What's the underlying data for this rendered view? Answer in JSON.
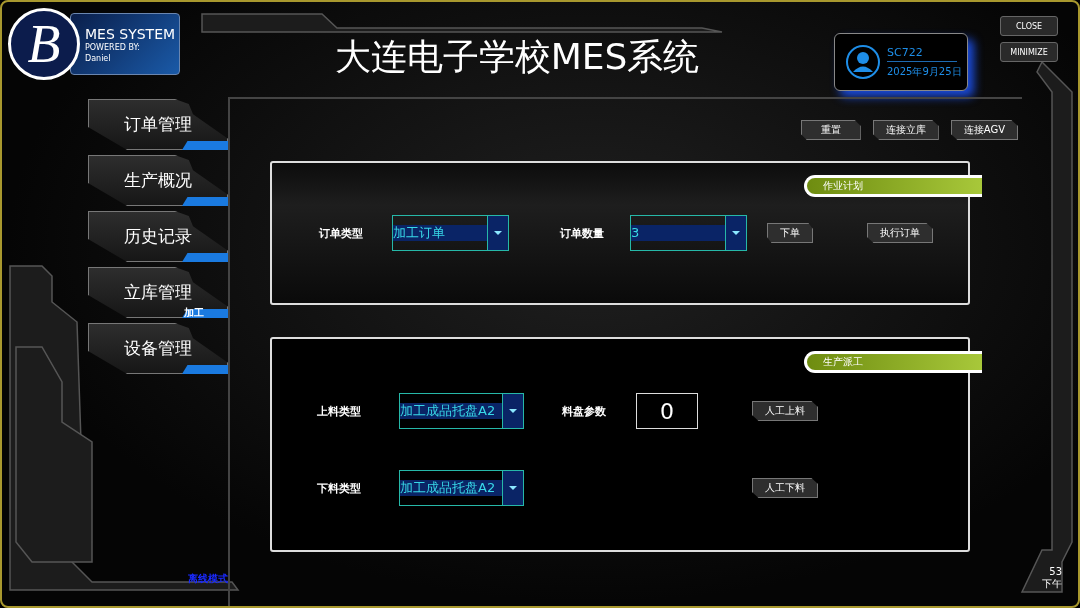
{
  "header": {
    "logo_letter": "B",
    "product": "MES SYSTEM",
    "powered_by": "POWERED BY:",
    "author": "Daniel",
    "title": "大连电子学校MES系统"
  },
  "user": {
    "name": "SC722",
    "date": "2025年9月25日"
  },
  "window_buttons": [
    "CLOSE",
    "MINIMIZE"
  ],
  "sidebar": {
    "items": [
      {
        "label": "订单管理"
      },
      {
        "label": "生产概况"
      },
      {
        "label": "历史记录"
      },
      {
        "label": "立库管理",
        "badge": "加工"
      },
      {
        "label": "设备管理"
      }
    ]
  },
  "toolbar": {
    "buttons": [
      "重置",
      "连接立库",
      "连接AGV"
    ]
  },
  "panels": [
    {
      "title": "作业计划",
      "rows": [
        [
          {
            "kind": "label",
            "text": "订单类型"
          },
          {
            "kind": "dropdown",
            "value": "加工订单"
          },
          {
            "kind": "label",
            "text": "订单数量"
          },
          {
            "kind": "dropdown",
            "value": "3"
          },
          {
            "kind": "button",
            "text": "下单"
          },
          {
            "kind": "button",
            "text": "执行订单"
          }
        ]
      ]
    },
    {
      "title": "生产派工",
      "rows": [
        [
          {
            "kind": "label",
            "text": "上料类型"
          },
          {
            "kind": "dropdown",
            "value": "加工成品托盘A2"
          },
          {
            "kind": "label",
            "text": "料盘参数"
          },
          {
            "kind": "number",
            "value": "0"
          },
          {
            "kind": "button",
            "text": "人工上料"
          }
        ],
        [
          {
            "kind": "label",
            "text": "下料类型"
          },
          {
            "kind": "dropdown",
            "value": "加工成品托盘A2"
          },
          "",
          "",
          {
            "kind": "button",
            "text": "人工下料"
          }
        ]
      ]
    }
  ],
  "status_bar": {
    "mode": "离线模式",
    "time": "53",
    "period": "下午"
  }
}
